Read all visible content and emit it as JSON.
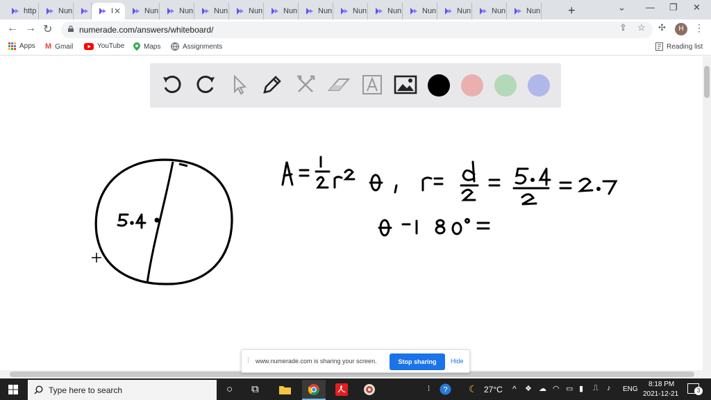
{
  "browser": {
    "tabs": [
      {
        "label": "http",
        "active": false,
        "recording": false
      },
      {
        "label": "Nun",
        "active": false,
        "recording": false
      },
      {
        "label": "I",
        "active": false,
        "recording": true
      },
      {
        "label": "I",
        "active": true,
        "recording": false
      },
      {
        "label": "Nun",
        "active": false,
        "recording": false
      },
      {
        "label": "Nun",
        "active": false,
        "recording": false
      },
      {
        "label": "Nun",
        "active": false,
        "recording": false
      },
      {
        "label": "Nun",
        "active": false,
        "recording": false
      },
      {
        "label": "Nun",
        "active": false,
        "recording": false
      },
      {
        "label": "Nun",
        "active": false,
        "recording": false
      },
      {
        "label": "Nun",
        "active": false,
        "recording": false
      },
      {
        "label": "Nun",
        "active": false,
        "recording": false
      },
      {
        "label": "Nun",
        "active": false,
        "recording": false
      },
      {
        "label": "Nun",
        "active": false,
        "recording": false
      },
      {
        "label": "Nun",
        "active": false,
        "recording": false
      },
      {
        "label": "Nun",
        "active": false,
        "recording": false
      }
    ],
    "url": "numerade.com/answers/whiteboard/",
    "profile_initial": "H",
    "bookmarks": {
      "apps": "Apps",
      "gmail": "Gmail",
      "youtube": "YouTube",
      "maps": "Maps",
      "assignments": "Assignments",
      "reading_list": "Reading list"
    }
  },
  "whiteboard": {
    "colors": {
      "black": "#000000",
      "red": "#eab0b0",
      "green": "#b3d9b8",
      "blue": "#b0b8ea"
    },
    "tools": [
      "undo-icon",
      "redo-icon",
      "pointer-icon",
      "pen-icon",
      "tools-icon",
      "eraser-icon",
      "text-icon",
      "image-icon"
    ],
    "drawing": {
      "diameter_label": "5.4",
      "equation_line1": "A = 1/2 r² θ , r = d/2 = 5.4/2 = 2.7",
      "equation_line2": "θ = 180° ="
    }
  },
  "sharing": {
    "message": "www.numerade.com is sharing your screen.",
    "stop": "Stop sharing",
    "hide": "Hide"
  },
  "taskbar": {
    "search_placeholder": "Type here to search",
    "temperature": "27°C",
    "language": "ENG",
    "time": "8:18 PM",
    "date": "2021-12-21",
    "notifications": "3"
  }
}
